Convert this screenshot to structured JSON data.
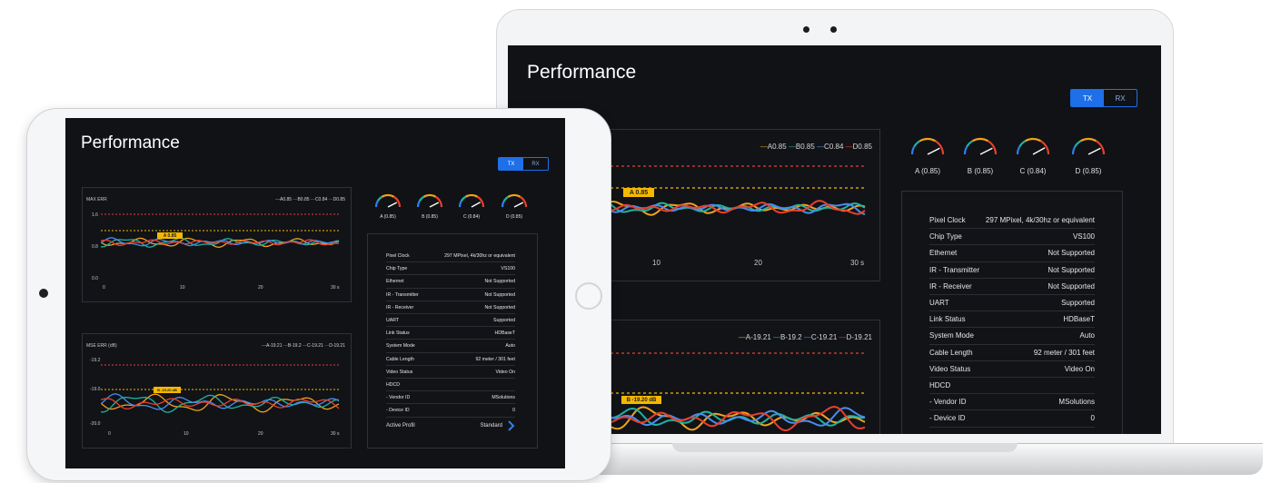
{
  "page_title": "Performance",
  "toggle": {
    "tx": "TX",
    "rx": "RX"
  },
  "gauges": [
    {
      "label": "A (0.85)",
      "value": 0.85,
      "tick_low": "0.5",
      "tick_mid": "1",
      "tick_high": "1"
    },
    {
      "label": "B (0.85)",
      "value": 0.85,
      "tick_low": "0.5",
      "tick_mid": "1",
      "tick_high": "1"
    },
    {
      "label": "C (0.84)",
      "value": 0.84,
      "tick_low": "0.5",
      "tick_mid": "1",
      "tick_high": "1"
    },
    {
      "label": "D (0.85)",
      "value": 0.85,
      "tick_low": "0.5",
      "tick_mid": "1",
      "tick_high": "1"
    }
  ],
  "tablet_gauges": [
    {
      "label": "A (0.85)"
    },
    {
      "label": "B (0.85)"
    },
    {
      "label": "C (0.84)"
    },
    {
      "label": "D (0.85)"
    }
  ],
  "chart1": {
    "title": "MAX ERR",
    "legend": [
      "A0.85",
      "B0.85",
      "C0.84",
      "D0.85"
    ],
    "legend_laptop": [
      "A0.85",
      "B0.85",
      "C0.84",
      "D0.85"
    ],
    "yticks": [
      "1.6",
      "0.8",
      "0.0"
    ],
    "xticks": [
      "0",
      "10",
      "20",
      "30 s"
    ],
    "xticks_laptop": [
      "10",
      "20",
      "30 s"
    ],
    "tag_label": "A 0.85"
  },
  "chart2": {
    "title": "MSE ERR (dB)",
    "legend": [
      "A-19.21",
      "B-19.2",
      "C-19.21",
      "D-19.21"
    ],
    "yticks": [
      "-19.2",
      "-19.0",
      "-20.0"
    ],
    "xticks": [
      "0",
      "10",
      "20",
      "30 s"
    ],
    "tag_label": "B -19.20 dB"
  },
  "series_colors": {
    "A": "#f0a21d",
    "B": "#1fb3a0",
    "C": "#4a8cf0",
    "D": "#e8402c"
  },
  "info": {
    "rows": [
      {
        "k": "Pixel Clock",
        "v": "297 MPixel, 4k/30hz or equivalent"
      },
      {
        "k": "Chip Type",
        "v": "VS100"
      },
      {
        "k": "Ethernet",
        "v": "Not Supported"
      },
      {
        "k": "IR - Transmitter",
        "v": "Not Supported"
      },
      {
        "k": "IR - Receiver",
        "v": "Not Supported"
      },
      {
        "k": "UART",
        "v": "Supported"
      },
      {
        "k": "Link Status",
        "v": "HDBaseT"
      },
      {
        "k": "System Mode",
        "v": "Auto"
      },
      {
        "k": "Cable Length",
        "v": "92 meter / 301 feet"
      },
      {
        "k": "Video Status",
        "v": "Video On"
      },
      {
        "k": "HDCD",
        "v": ""
      },
      {
        "k": "- Vendor ID",
        "v": "MSolutions"
      },
      {
        "k": "- Device ID",
        "v": "0"
      }
    ],
    "active_profile_label": "Active Profil",
    "active_profile_value": "Standard",
    "chevron": "chevron-right-icon"
  }
}
